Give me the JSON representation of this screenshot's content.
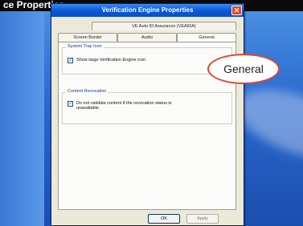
{
  "banner": {
    "text": "ce Properties"
  },
  "window": {
    "title": "Verification Engine Properties",
    "close_glyph": "✕"
  },
  "tabs": {
    "top": [
      "VE Auto ID Assurance (VEAIDA)"
    ],
    "bottom": [
      "Screen Border",
      "Audio",
      "General"
    ],
    "active": "General"
  },
  "panel": {
    "system_tray": {
      "title": "System Tray Icon",
      "checkbox_label": "Show large Verification Engine icon",
      "checked": true
    },
    "content_revocation": {
      "title": "Content Revocation",
      "checkbox_label": "Do not validate content if the revocation status is unavailable.",
      "checked": true
    }
  },
  "buttons": {
    "ok": "OK",
    "apply": "Apply"
  },
  "callout": {
    "text": "General"
  },
  "colors": {
    "titlebar": "#0a5ad8",
    "callout_border": "#e0462e",
    "desktop": "#2a6ad0",
    "dialog_face": "#ece9d8"
  }
}
